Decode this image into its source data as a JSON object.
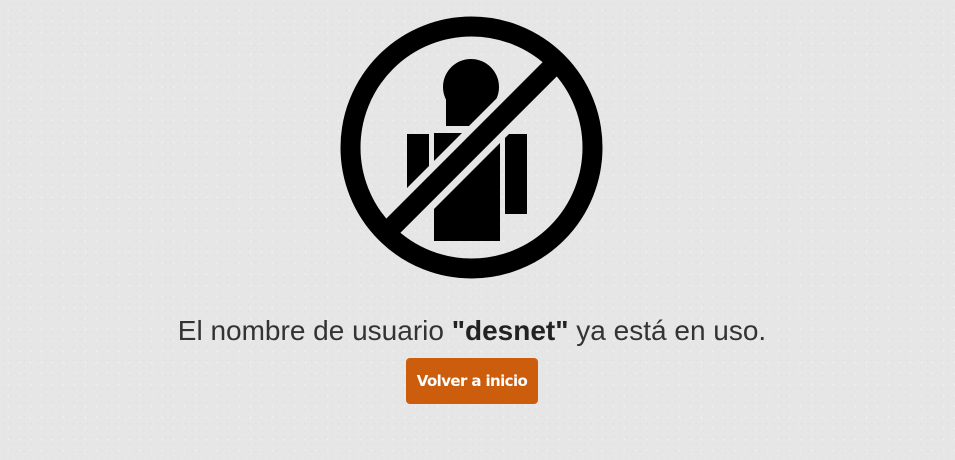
{
  "icon": {
    "name": "no-user-icon",
    "color": "#000000"
  },
  "message": {
    "prefix": "El nombre de usuario ",
    "username": "\"desnet\"",
    "suffix": " ya está en uso."
  },
  "button": {
    "label": "Volver a inicio",
    "color": "#cc5d0c",
    "text_color": "#ffffff"
  }
}
